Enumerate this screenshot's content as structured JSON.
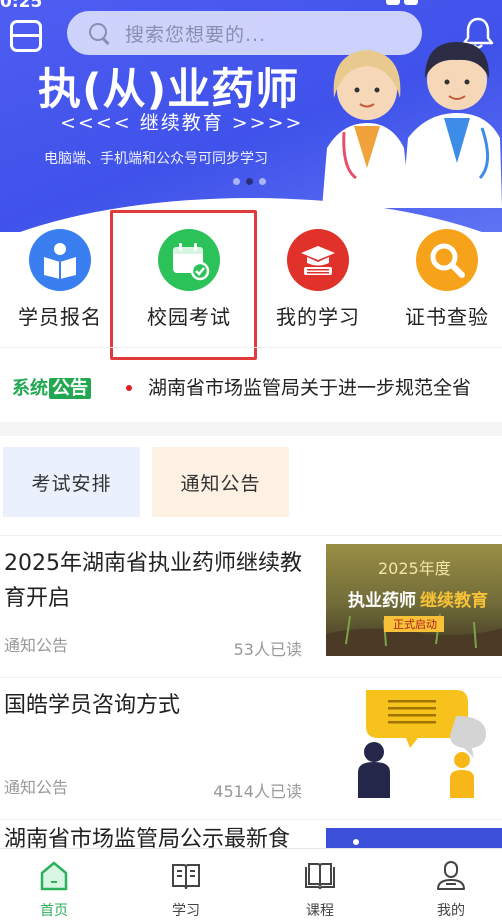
{
  "status": {
    "time": "0:25"
  },
  "search": {
    "placeholder": "搜索您想要的..."
  },
  "banner": {
    "title": "执(从)业药师",
    "subtitle": "<<<<  继续教育  >>>>",
    "note": "电脑端、手机端和公众号可同步学习"
  },
  "quick": {
    "items": [
      {
        "label": "学员报名",
        "icon": "book-reader-icon",
        "color": "#3a7ff0"
      },
      {
        "label": "校园考试",
        "icon": "calendar-check-icon",
        "color": "#2bc25a"
      },
      {
        "label": "我的学习",
        "icon": "graduation-cap-icon",
        "color": "#e0312a"
      },
      {
        "label": "证书查验",
        "icon": "magnifier-icon",
        "color": "#f7a21b"
      }
    ]
  },
  "notice": {
    "tag_prefix": "系统",
    "tag_highlight": "公告",
    "text": "湖南省市场监管局关于进一步规范全省"
  },
  "tabs": [
    {
      "label": "考试安排"
    },
    {
      "label": "通知公告"
    }
  ],
  "articles": [
    {
      "title": "2025年湖南省执业药师继续教育开启",
      "category": "通知公告",
      "reads": "53人已读",
      "image_year": "2025年度",
      "image_line1": "执业药师",
      "image_line2": "继续教育",
      "image_badge": "正式启动"
    },
    {
      "title": "国皓学员咨询方式",
      "category": "通知公告",
      "reads": "4514人已读"
    },
    {
      "title": "湖南省市场监管局公示最新食"
    }
  ],
  "bottom_nav": [
    {
      "label": "首页",
      "icon": "home-icon",
      "active": true
    },
    {
      "label": "学习",
      "icon": "open-book-icon"
    },
    {
      "label": "课程",
      "icon": "course-book-icon"
    },
    {
      "label": "我的",
      "icon": "user-icon"
    }
  ],
  "colors": {
    "accent_green": "#2bb15a",
    "banner_blue": "#4a58ee",
    "highlight_red": "#e03a3a"
  }
}
